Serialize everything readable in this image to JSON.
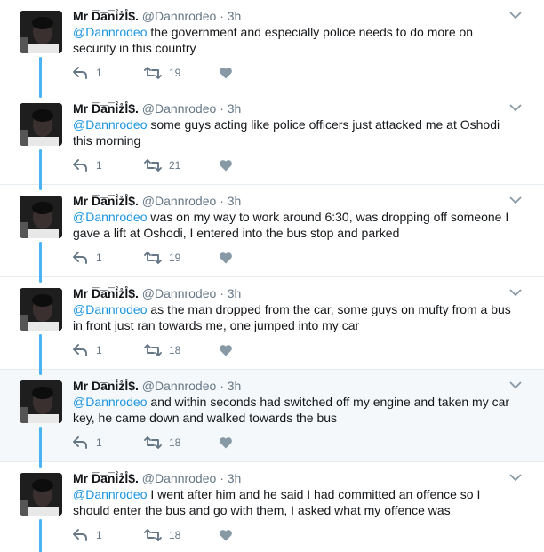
{
  "colors": {
    "accent": "#1b95e0",
    "thread_line": "#4ab3f4",
    "highlight_bg": "#f5f8fa",
    "muted": "#657786"
  },
  "icons": {
    "reply": "reply-icon",
    "retweet": "retweet-icon",
    "like": "heart-icon",
    "menu": "chevron-down-icon"
  },
  "tweets": [
    {
      "author_name": "Mr D̅a̅n̅i̊z̊l̊$.",
      "handle": "@Dannrodeo",
      "time": "3h",
      "mention": "@Dannrodeo",
      "body": " the government and especially police needs to do more on security in this country",
      "reply_count": "1",
      "retweet_count": "19",
      "highlighted": false
    },
    {
      "author_name": "Mr D̅a̅n̅i̊z̊l̊$.",
      "handle": "@Dannrodeo",
      "time": "3h",
      "mention": "@Dannrodeo",
      "body": " some guys acting like police officers just attacked me at Oshodi this morning",
      "reply_count": "1",
      "retweet_count": "21",
      "highlighted": false
    },
    {
      "author_name": "Mr D̅a̅n̅i̊z̊l̊$.",
      "handle": "@Dannrodeo",
      "time": "3h",
      "mention": "@Dannrodeo",
      "body": " was on my way to work around 6:30, was dropping off someone I gave a lift at Oshodi, I entered into the bus stop and parked",
      "reply_count": "1",
      "retweet_count": "19",
      "highlighted": false
    },
    {
      "author_name": "Mr D̅a̅n̅i̊z̊l̊$.",
      "handle": "@Dannrodeo",
      "time": "3h",
      "mention": "@Dannrodeo",
      "body": " as the man dropped from the car, some guys on mufty from a bus in front just ran towards me, one jumped into my car",
      "reply_count": "1",
      "retweet_count": "18",
      "highlighted": false
    },
    {
      "author_name": "Mr D̅a̅n̅i̊z̊l̊$.",
      "handle": "@Dannrodeo",
      "time": "3h",
      "mention": "@Dannrodeo",
      "body": " and within seconds had switched off my engine and taken my car key, he came down and walked towards the bus",
      "reply_count": "1",
      "retweet_count": "18",
      "highlighted": true
    },
    {
      "author_name": "Mr D̅a̅n̅i̊z̊l̊$.",
      "handle": "@Dannrodeo",
      "time": "3h",
      "mention": "@Dannrodeo",
      "body": " I went after him and he said I had committed an offence so I should enter the bus and go with them,  I asked what my offence was",
      "reply_count": "1",
      "retweet_count": "18",
      "highlighted": false
    }
  ]
}
